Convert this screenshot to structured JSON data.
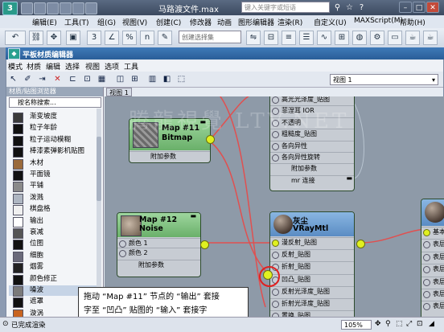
{
  "app": {
    "title": "马路渡文件.max",
    "search_placeholder": "键入关键字或短语"
  },
  "menubar": [
    "编辑(E)",
    "工具(T)",
    "组(G)",
    "视图(V)",
    "创建(C)",
    "修改器",
    "动画",
    "图形编辑器",
    "渲染(R)",
    "自定义(U)",
    "MAXScript(M)",
    "帮助(H)"
  ],
  "toolbar": {
    "selection_set": "创建选择集",
    "snap_labels": [
      "3",
      "%",
      "n"
    ]
  },
  "sme": {
    "title": "平板材质编辑器",
    "menu": [
      "模式",
      "材质",
      "编辑",
      "选择",
      "视图",
      "选项",
      "工具"
    ],
    "view_select": "视图 1",
    "view_tab": "视图 1"
  },
  "browser": {
    "header": "材质/贴图浏览器",
    "search_placeholder": "按名称搜索...",
    "items": [
      {
        "label": "渐变坡度",
        "color": "#3a3a3a"
      },
      {
        "label": "粒子年龄",
        "color": "#111111"
      },
      {
        "label": "粒子运动模糊",
        "color": "#111111"
      },
      {
        "label": "棒漆素弹影机贴图",
        "color": "#111111"
      },
      {
        "label": "木材",
        "color": "#9a6a3a"
      },
      {
        "label": "平面镜",
        "color": "#111111"
      },
      {
        "label": "平铺",
        "color": "#8a8a8a"
      },
      {
        "label": "泼溅",
        "color": "#aeb6c2"
      },
      {
        "label": "棋盘格",
        "color": "#f0f0f0"
      },
      {
        "label": "输出",
        "color": "#ffffff"
      },
      {
        "label": "衰减",
        "color": "#555555"
      },
      {
        "label": "位图",
        "color": "#111111"
      },
      {
        "label": "细胞",
        "color": "#6a6a7a"
      },
      {
        "label": "烟雾",
        "color": "#222222"
      },
      {
        "label": "颜色修正",
        "color": "#111111"
      },
      {
        "label": "噪波",
        "color": "#7a7a7a"
      },
      {
        "label": "遮罩",
        "color": "#111111"
      },
      {
        "label": "漩涡",
        "color": "#c86420"
      }
    ]
  },
  "nodes": {
    "map11": {
      "title": "Map #11",
      "type": "Bitmap",
      "rows": [
        "附加参数"
      ]
    },
    "map12": {
      "title": "Map #12",
      "type": "Noise",
      "rows": [
        "颜色 1",
        "颜色 2",
        "附加参数"
      ]
    },
    "upper": {
      "rows": [
        "高光光泽度_贴图",
        "菲涅耳 IOR",
        "不透明",
        "粗糙度_贴图",
        "各向异性",
        "各向异性旋转",
        "附加参数",
        "mr 连接"
      ]
    },
    "vray": {
      "title": "灰尘",
      "type": "VRayMtl",
      "rows": [
        "漫反射_贴图",
        "反射_贴图",
        "折射_贴图",
        "凹凸_贴图",
        "反射光泽度_贴图",
        "折射光泽度_贴图",
        "置换_贴图"
      ]
    },
    "right": {
      "rows": [
        "基本",
        "表层",
        "表层",
        "表层",
        "表层",
        "表层",
        "表层"
      ]
    }
  },
  "tooltip": {
    "line1": "拖动 “Map #11” 节点的 “输出” 套接",
    "line2": "字至 “凹凸” 贴图的 “输入” 套接字"
  },
  "status": {
    "text": "已完成渲染",
    "zoom": "105%"
  },
  "watermark": "腾龍視覺 LTV.NET"
}
